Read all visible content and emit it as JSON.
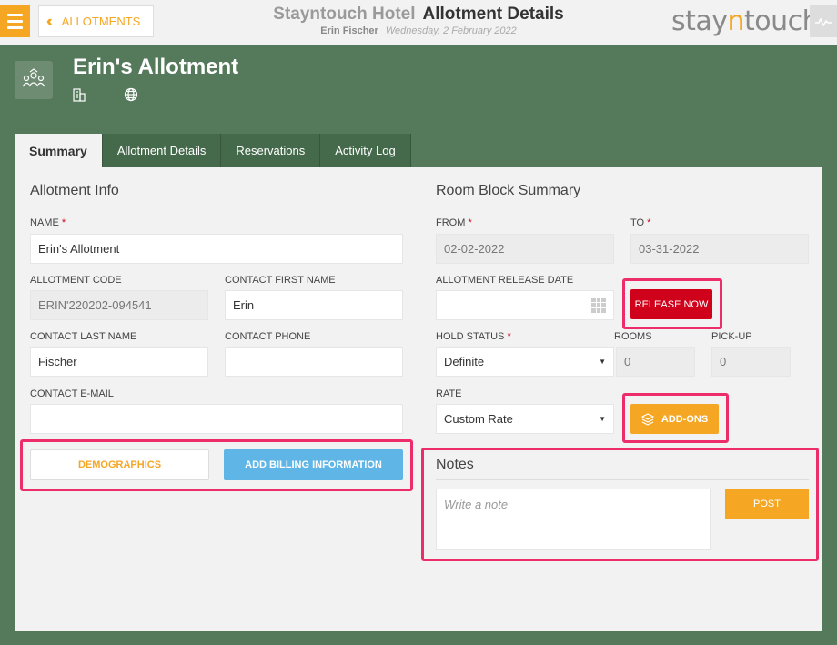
{
  "nav": {
    "back_label": "ALLOTMENTS",
    "hotel_name": "Stayntouch Hotel",
    "page_title": "Allotment Details",
    "user_name": "Erin Fischer",
    "date": "Wednesday, 2 February 2022",
    "logo_pre": "stay",
    "logo_n": "n",
    "logo_post": "touch"
  },
  "header": {
    "allotment_name": "Erin's Allotment"
  },
  "tabs": [
    {
      "label": "Summary",
      "active": true
    },
    {
      "label": "Allotment Details",
      "active": false
    },
    {
      "label": "Reservations",
      "active": false
    },
    {
      "label": "Activity Log",
      "active": false
    }
  ],
  "allotment_info": {
    "title": "Allotment Info",
    "name_label": "NAME",
    "name_value": "Erin's Allotment",
    "code_label": "ALLOTMENT CODE",
    "code_value": "ERIN'220202-094541",
    "first_name_label": "CONTACT FIRST NAME",
    "first_name_value": "Erin",
    "last_name_label": "CONTACT LAST NAME",
    "last_name_value": "Fischer",
    "phone_label": "CONTACT PHONE",
    "phone_value": "",
    "email_label": "CONTACT E-MAIL",
    "email_value": "",
    "demographics_label": "DEMOGRAPHICS",
    "billing_label": "ADD BILLING INFORMATION"
  },
  "room_block": {
    "title": "Room Block Summary",
    "from_label": "FROM",
    "from_value": "02-02-2022",
    "to_label": "TO",
    "to_value": "03-31-2022",
    "release_date_label": "ALLOTMENT RELEASE DATE",
    "release_date_value": "",
    "release_now_label": "RELEASE NOW",
    "hold_status_label": "HOLD STATUS",
    "hold_status_value": "Definite",
    "rooms_label": "ROOMS",
    "rooms_value": "0",
    "pickup_label": "PICK-UP",
    "pickup_value": "0",
    "rate_label": "RATE",
    "rate_value": "Custom Rate",
    "addons_label": "ADD-ONS"
  },
  "notes": {
    "title": "Notes",
    "placeholder": "Write a note",
    "post_label": "POST"
  },
  "colors": {
    "accent": "#f5a623",
    "background": "#557a5b",
    "highlight": "#ec2d6a",
    "release": "#d0021b",
    "billing": "#5fb6e6"
  }
}
